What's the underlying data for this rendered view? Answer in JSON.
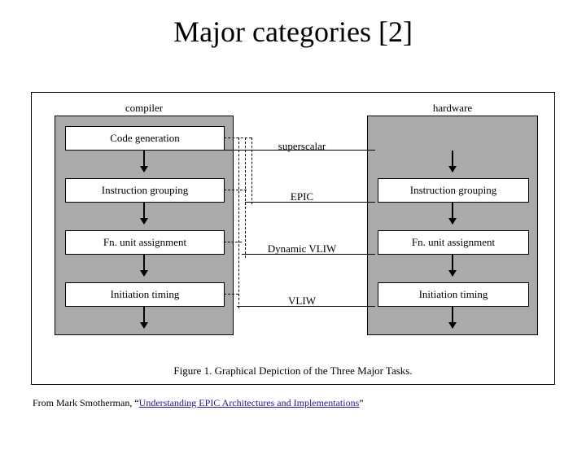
{
  "title": "Major categories [2]",
  "figure": {
    "left_header": "compiler",
    "right_header": "hardware",
    "left_boxes": [
      "Code generation",
      "Instruction grouping",
      "Fn. unit assignment",
      "Initiation timing"
    ],
    "right_boxes": [
      "Instruction grouping",
      "Fn. unit assignment",
      "Initiation timing"
    ],
    "center_labels": [
      "superscalar",
      "EPIC",
      "Dynamic VLIW",
      "VLIW"
    ],
    "caption": "Figure 1. Graphical Depiction of the Three Major Tasks."
  },
  "attribution": {
    "prefix": "From Mark Smotherman, “",
    "link_text": "Understanding EPIC Architectures and Implementations",
    "suffix": "”"
  }
}
